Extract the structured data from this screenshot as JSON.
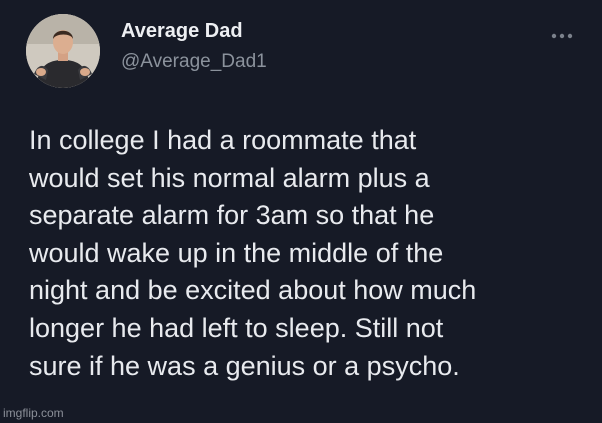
{
  "author": {
    "display_name": "Average Dad",
    "handle": "@Average_Dad1"
  },
  "tweet": {
    "text": "In college I had a roommate that\nwould set his normal alarm plus a\nseparate alarm for 3am so that he\nwould wake up in the middle of the\nnight and be excited about how much\nlonger he had left to sleep. Still not\nsure if he was a genius or a psycho."
  },
  "watermark": "imgflip.com",
  "icons": {
    "more": "more-horizontal-icon",
    "avatar": "profile-photo"
  },
  "colors": {
    "background": "#161a26",
    "text": "#e8eaee",
    "handle": "#8b929c"
  }
}
